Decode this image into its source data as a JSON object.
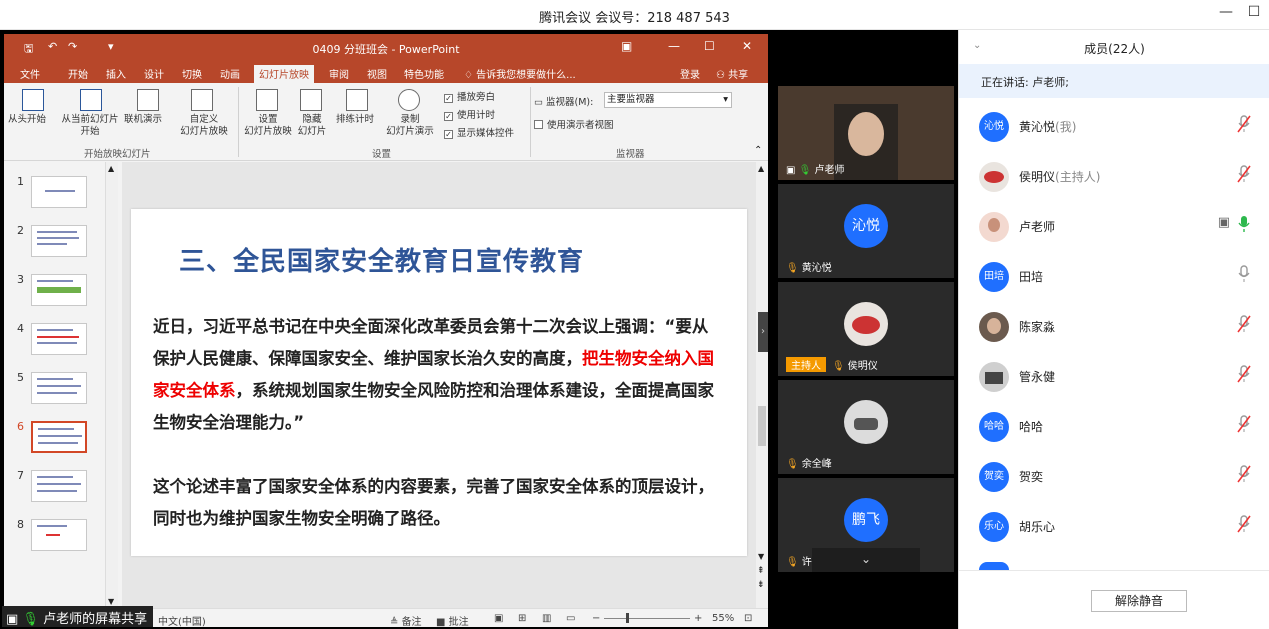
{
  "meeting": {
    "title": "腾讯会议 会议号：218 487 543"
  },
  "ppt": {
    "doc_title": "0409 分班班会 - PowerPoint",
    "tabs": [
      "文件",
      "开始",
      "插入",
      "设计",
      "切换",
      "动画",
      "幻灯片放映",
      "审阅",
      "视图",
      "特色功能"
    ],
    "active_tab": "幻灯片放映",
    "tell_me": "告诉我您想要做什么...",
    "login": "登录",
    "share": "共享",
    "ribbon": {
      "from_start": "从头开始",
      "from_current": "从当前幻灯片",
      "from_current2": "开始",
      "online": "联机演示",
      "custom": "自定义",
      "custom2": "幻灯片放映",
      "group1": "开始放映幻灯片",
      "setup": "设置",
      "setup2": "幻灯片放映",
      "hide": "隐藏",
      "hide2": "幻灯片",
      "rehearse": "排练计时",
      "record": "录制",
      "record2": "幻灯片演示",
      "play_narr": "播放旁白",
      "use_timing": "使用计时",
      "show_media": "显示媒体控件",
      "group2": "设置",
      "monitor_label": "监视器(M):",
      "monitor_value": "主要监视器",
      "presenter_view": "使用演示者视图",
      "group3": "监视器"
    },
    "slide_numbers": [
      "1",
      "2",
      "3",
      "4",
      "5",
      "6",
      "7",
      "8"
    ],
    "slide": {
      "heading": "三、全民国家安全教育日宣传教育",
      "para1_a": "近日，习近平总书记在中央全面深化改革委员会第十二次会议上强调：“要从保护人民健康、保障国家安全、维护国家长治久安的高度，",
      "para1_red": "把生物安全纳入国家安全体系",
      "para1_b": "，系统规划国家生物安全风险防控和治理体系建设，全面提高国家生物安全治理能力。”",
      "para2": "这个论述丰富了国家安全体系的内容要素，完善了国家安全体系的顶层设计，同时也为维护国家生物安全明确了路径。"
    },
    "status": {
      "lang": "中文(中国)",
      "notes": "备注",
      "comments": "批注",
      "zoom": "55%"
    }
  },
  "screen_share_label": "卢老师的屏幕共享",
  "video_tiles": [
    {
      "name": "卢老师",
      "avatar": ""
    },
    {
      "name": "黄沁悦",
      "avatar": "沁悦"
    },
    {
      "name": "侯明仪",
      "avatar": "",
      "tag": "主持人"
    },
    {
      "name": "余全峰",
      "avatar": ""
    },
    {
      "name": "许鹏飞",
      "avatar": "鹏飞"
    }
  ],
  "panel": {
    "title": "成员(22人)",
    "speaking": "正在讲话: 卢老师;",
    "unmute_button": "解除静音",
    "members": [
      {
        "avatar": "沁悦",
        "name": "黄沁悦",
        "tag": "(我)",
        "mic": "off"
      },
      {
        "avatar": "",
        "name": "侯明仪",
        "tag": "(主持人)",
        "mic": "off"
      },
      {
        "avatar": "",
        "name": "卢老师",
        "tag": "",
        "mic": "on"
      },
      {
        "avatar": "田培",
        "name": "田培",
        "tag": "",
        "mic": "idle"
      },
      {
        "avatar": "",
        "name": "陈家淼",
        "tag": "",
        "mic": "off"
      },
      {
        "avatar": "",
        "name": "管永健",
        "tag": "",
        "mic": "off"
      },
      {
        "avatar": "哈哈",
        "name": "哈哈",
        "tag": "",
        "mic": "off"
      },
      {
        "avatar": "贺奕",
        "name": "贺奕",
        "tag": "",
        "mic": "off"
      },
      {
        "avatar": "乐心",
        "name": "胡乐心",
        "tag": "",
        "mic": "off"
      }
    ]
  },
  "colors": {
    "ppt_red": "#b7472a",
    "tencent_blue": "#1f6fff",
    "slide_heading": "#2f5597",
    "highlight_red": "#e00000"
  }
}
